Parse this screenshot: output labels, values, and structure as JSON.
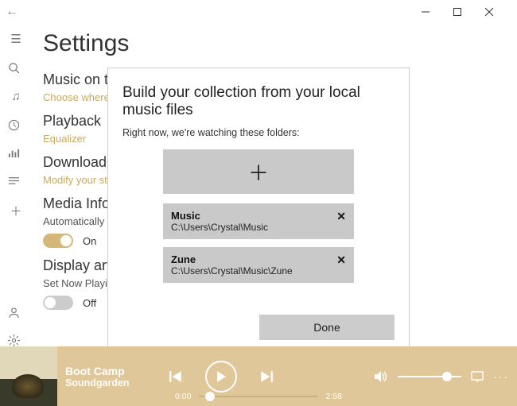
{
  "page_title": "Settings",
  "sections": {
    "music_on": {
      "heading": "Music on this PC",
      "sub": "Choose where we look for music"
    },
    "playback": {
      "heading": "Playback",
      "sub": "Equalizer"
    },
    "download": {
      "heading": "Download",
      "sub": "Modify your storage settings"
    },
    "media": {
      "heading": "Media Info",
      "sub": "Automatically retrieve and update missing album art and metadata",
      "toggle_on": "On"
    },
    "display": {
      "heading": "Display artist",
      "sub": "Set Now Playing artist art as my lock screen",
      "toggle_off": "Off"
    }
  },
  "dialog": {
    "title": "Build your collection from your local music files",
    "subtitle": "Right now, we're watching these folders:",
    "folders": [
      {
        "name": "Music",
        "path": "C:\\Users\\Crystal\\Music"
      },
      {
        "name": "Zune",
        "path": "C:\\Users\\Crystal\\Music\\Zune"
      }
    ],
    "done": "Done"
  },
  "player": {
    "title": "Boot Camp",
    "artist": "Soundgarden",
    "elapsed": "0:00",
    "total": "2:58"
  }
}
